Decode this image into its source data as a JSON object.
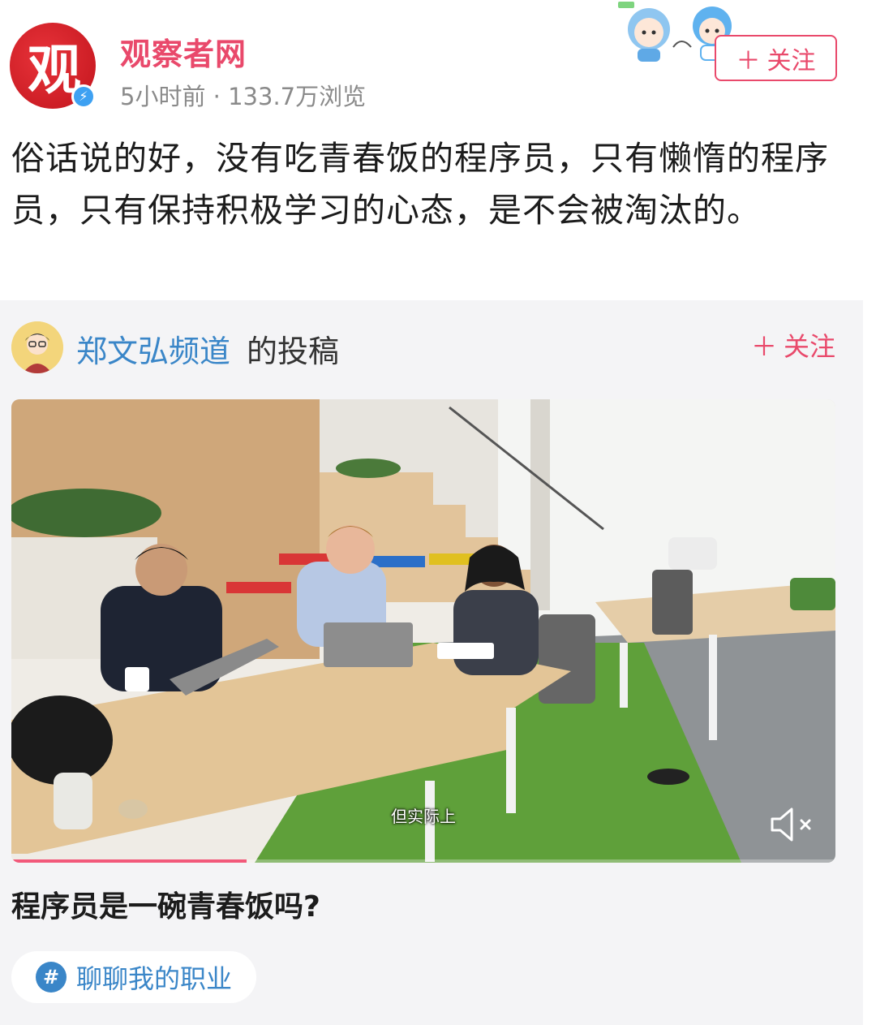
{
  "header": {
    "avatar_glyph": "观",
    "account_name": "观察者网",
    "meta": "5小时前 · 133.7万浏览",
    "follow_label": "关注"
  },
  "post": {
    "text": "俗话说的好，没有吃青春饭的程序员，只有懒惰的程序员，只有保持积极学习的心态，是不会被淘汰的。"
  },
  "repost": {
    "author_name": "郑文弘频道",
    "author_suffix": "的投稿",
    "follow_label": "关注",
    "video": {
      "subtitle": "但实际上",
      "progress_fraction": 0.285,
      "muted": true
    },
    "video_title": "程序员是一碗青春饭吗?",
    "tag": {
      "icon": "#",
      "label": "聊聊我的职业"
    }
  },
  "colors": {
    "accent_pink": "#e9496b",
    "link_blue": "#3a86c8",
    "meta_gray": "#8a8a8a",
    "section_bg": "#f4f4f6"
  }
}
